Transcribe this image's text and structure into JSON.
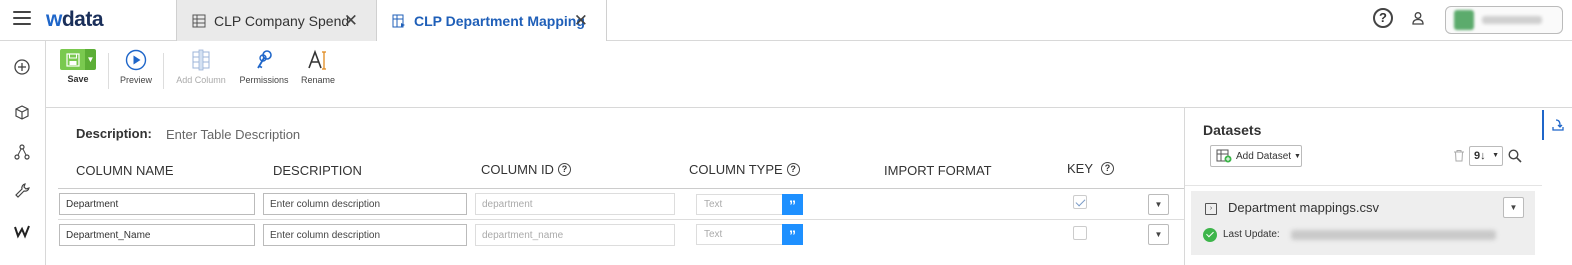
{
  "app": {
    "logo_w": "w",
    "logo_rest": "data"
  },
  "tabs": [
    {
      "label": "CLP Company Spend",
      "icon": "table-icon",
      "active": false
    },
    {
      "label": "CLP Department Mapping",
      "icon": "mapping-icon",
      "active": true
    }
  ],
  "header": {
    "help": "?"
  },
  "toolbar": {
    "save": "Save",
    "preview": "Preview",
    "add_column": "Add Column",
    "permissions": "Permissions",
    "rename": "Rename"
  },
  "main": {
    "description_label": "Description:",
    "description_placeholder": "Enter Table Description",
    "columns": {
      "name": "COLUMN NAME",
      "description": "DESCRIPTION",
      "id": "COLUMN ID",
      "type": "COLUMN TYPE",
      "import_format": "IMPORT FORMAT",
      "key": "KEY"
    },
    "rows": [
      {
        "name": "Department",
        "description_placeholder": "Enter column description",
        "id_placeholder": "department",
        "type": "Text",
        "type_icon": "”",
        "key": true
      },
      {
        "name": "Department_Name",
        "description_placeholder": "Enter column description",
        "id_placeholder": "department_name",
        "type": "Text",
        "type_icon": "”",
        "key": false
      }
    ]
  },
  "datasets": {
    "title": "Datasets",
    "add_label": "Add Dataset",
    "sort_label": "9↓",
    "items": [
      {
        "name": "Department mappings.csv",
        "last_update_label": "Last Update:"
      }
    ]
  },
  "colors": {
    "accent": "#1f66c9",
    "save_green": "#7ac94f",
    "type_blue": "#1e90ff",
    "ok_green": "#3db54a"
  }
}
